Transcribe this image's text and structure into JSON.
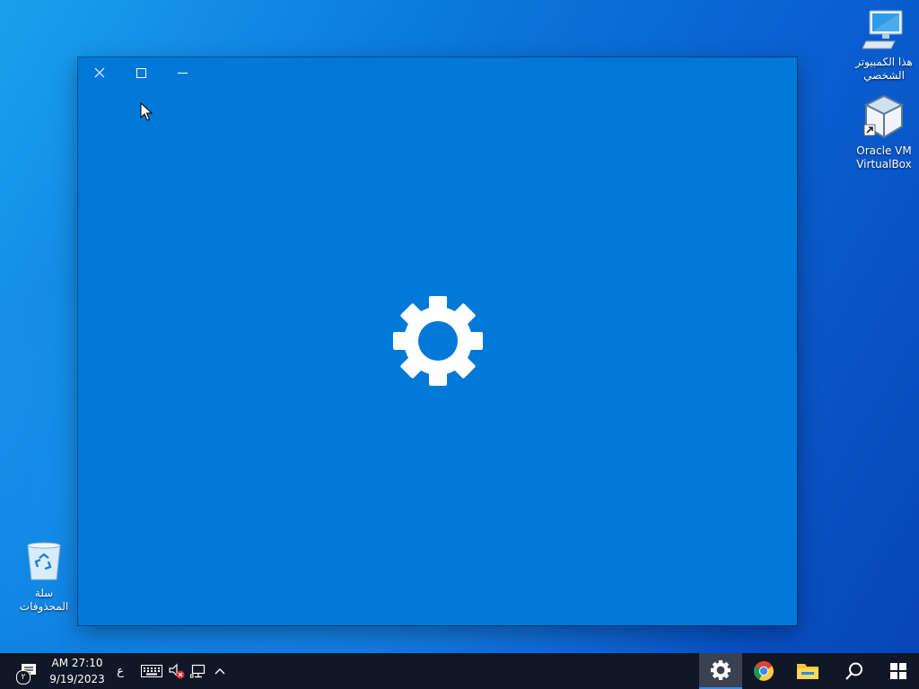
{
  "desktop": {
    "icons": [
      {
        "id": "this-pc",
        "label_line1": "هذا الكمبيوتر",
        "label_line2": "الشخصي"
      },
      {
        "id": "virtualbox",
        "label_line1": "Oracle VM",
        "label_line2": "VirtualBox"
      },
      {
        "id": "recycle-bin",
        "label_line1": "سلة",
        "label_line2": "المحذوفات"
      }
    ]
  },
  "window": {
    "app_icon": "gear-icon",
    "background": "#0078d7",
    "controls": {
      "close": "close-icon",
      "maximize": "maximize-icon",
      "minimize": "minimize-icon"
    }
  },
  "taskbar": {
    "clock": {
      "time": "AM 27:10",
      "date": "9/19/2023"
    },
    "input_language": "ع",
    "tray": [
      "notification-icon",
      "keyboard-icon",
      "volume-muted-icon",
      "network-icon",
      "chevron-up-icon"
    ],
    "notification_badge": "٢",
    "pinned": [
      "settings-icon",
      "chrome-icon",
      "file-explorer-icon",
      "search-icon",
      "start-icon"
    ],
    "active": "settings-icon",
    "accent": "#3a8ce0"
  }
}
